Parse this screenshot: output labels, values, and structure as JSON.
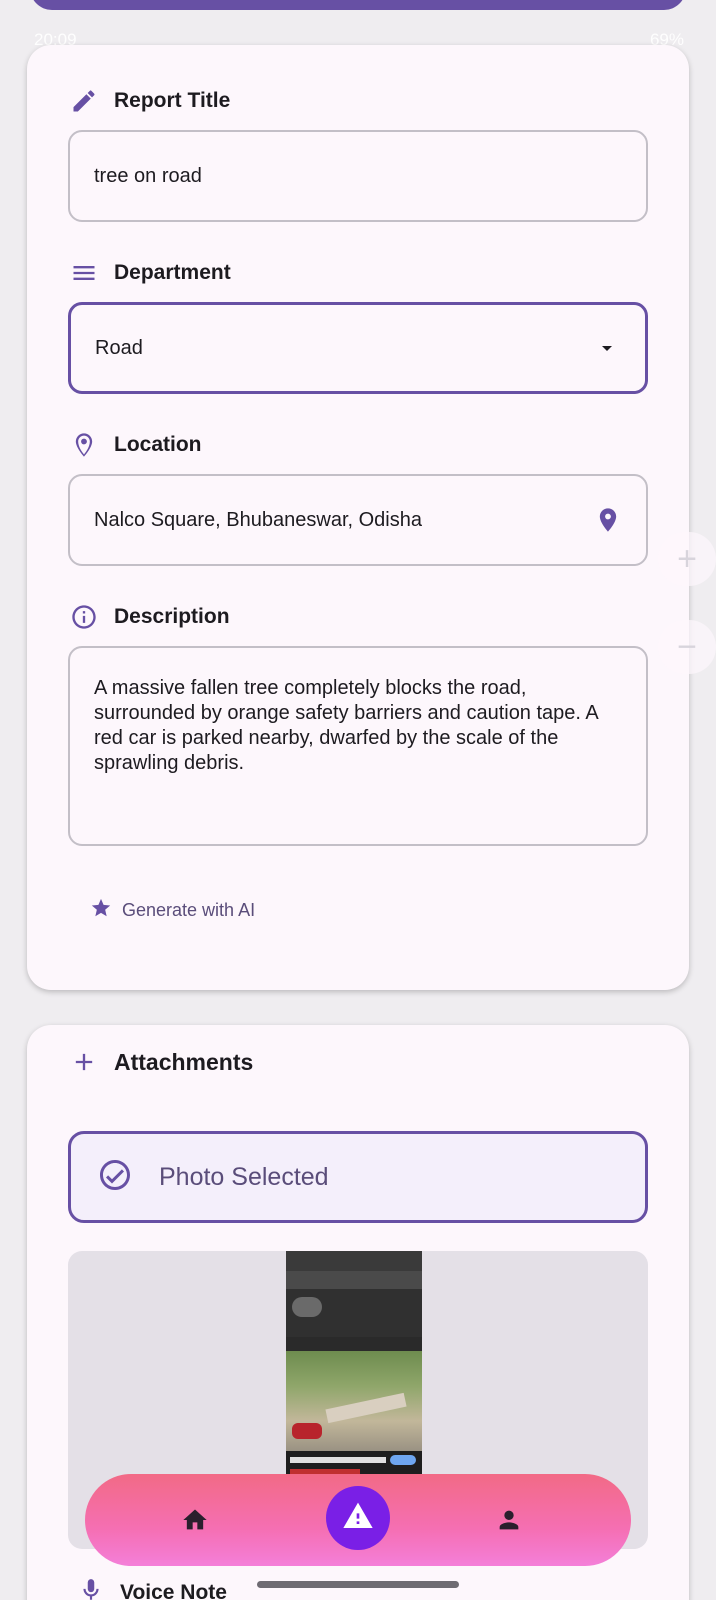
{
  "status_bar": {
    "time": "20:09",
    "battery": "69%"
  },
  "form": {
    "title": {
      "label": "Report Title",
      "value": "tree on road",
      "icon": "pencil-icon"
    },
    "department": {
      "label": "Department",
      "value": "Road",
      "icon": "list-icon"
    },
    "location": {
      "label": "Location",
      "value": "Nalco Square, Bhubaneswar, Odisha",
      "icon": "location-pin-icon"
    },
    "description": {
      "label": "Description",
      "value": "A massive fallen tree completely blocks the road, surrounded by orange safety barriers and caution tape. A red car is parked nearby, dwarfed by the scale of the sprawling debris.",
      "icon": "info-icon"
    },
    "ai_button": {
      "label": "Generate with AI",
      "icon": "star-icon"
    }
  },
  "attachments": {
    "label": "Attachments",
    "photo_status": "Photo Selected"
  },
  "voice_note": {
    "label": "Voice Note"
  },
  "zoom": {
    "in": "+",
    "out": "−"
  },
  "colors": {
    "accent": "#6750a4",
    "card": "#fdf7fc",
    "fab": "#7a1fe6"
  }
}
